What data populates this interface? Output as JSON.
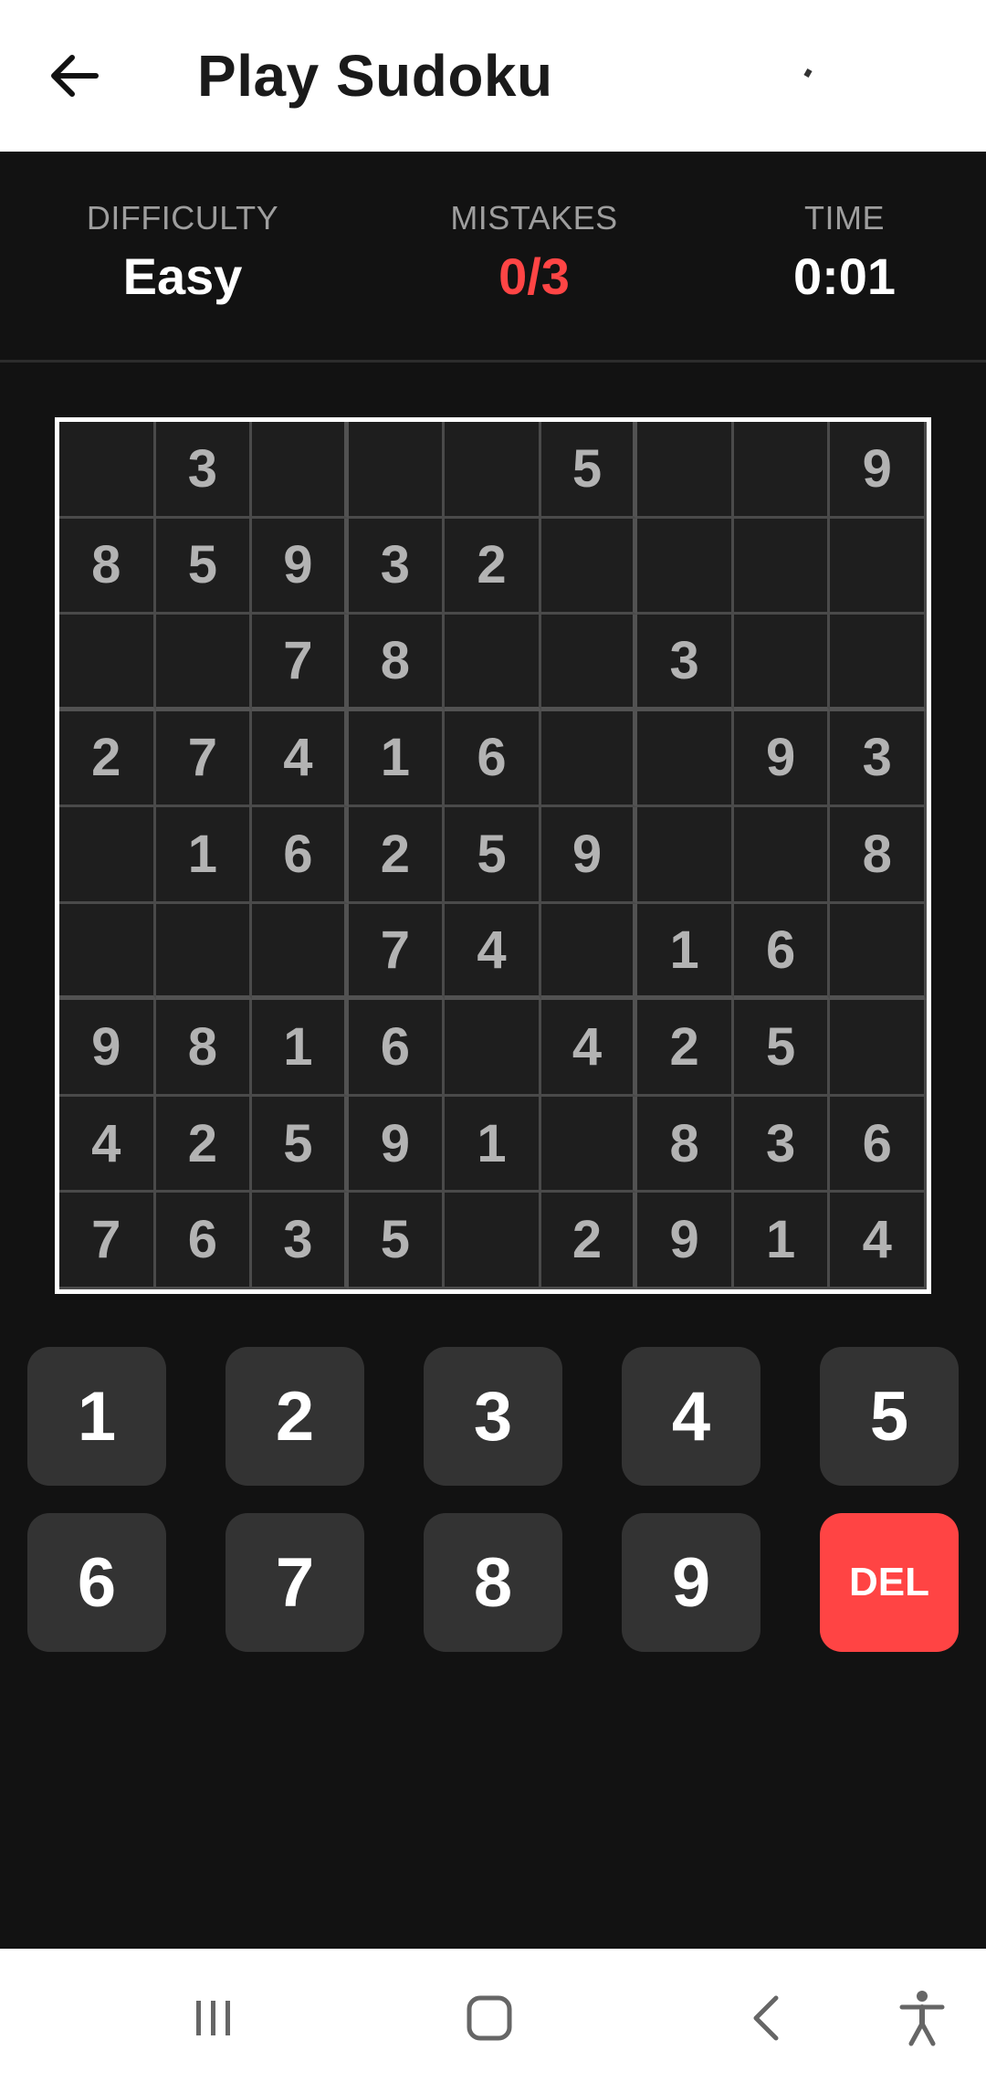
{
  "header": {
    "title": "Play Sudoku"
  },
  "stats": {
    "difficulty_label": "DIFFICULTY",
    "difficulty_value": "Easy",
    "mistakes_label": "MISTAKES",
    "mistakes_value": "0/3",
    "time_label": "TIME",
    "time_value": "0:01"
  },
  "board": {
    "cells": [
      [
        "",
        "3",
        "",
        "",
        "",
        "5",
        "",
        "",
        "9"
      ],
      [
        "8",
        "5",
        "9",
        "3",
        "2",
        "",
        "",
        "",
        ""
      ],
      [
        "",
        "",
        "7",
        "8",
        "",
        "",
        "3",
        "",
        ""
      ],
      [
        "2",
        "7",
        "4",
        "1",
        "6",
        "",
        "",
        "9",
        "3"
      ],
      [
        "",
        "1",
        "6",
        "2",
        "5",
        "9",
        "",
        "",
        "8"
      ],
      [
        "",
        "",
        "",
        "7",
        "4",
        "",
        "1",
        "6",
        ""
      ],
      [
        "9",
        "8",
        "1",
        "6",
        "",
        "4",
        "2",
        "5",
        ""
      ],
      [
        "4",
        "2",
        "5",
        "9",
        "1",
        "",
        "8",
        "3",
        "6"
      ],
      [
        "7",
        "6",
        "3",
        "5",
        "",
        "2",
        "9",
        "1",
        "4"
      ]
    ]
  },
  "keypad": {
    "keys": [
      "1",
      "2",
      "3",
      "4",
      "5",
      "6",
      "7",
      "8",
      "9"
    ],
    "delete_label": "DEL"
  },
  "colors": {
    "accent_red": "#ff4545",
    "key_bg": "#333333",
    "background": "#121212"
  },
  "icons": {
    "back": "arrow-left-icon",
    "nav_recents": "recents-icon",
    "nav_home": "home-icon",
    "nav_back": "chevron-left-icon",
    "nav_accessibility": "accessibility-icon"
  }
}
